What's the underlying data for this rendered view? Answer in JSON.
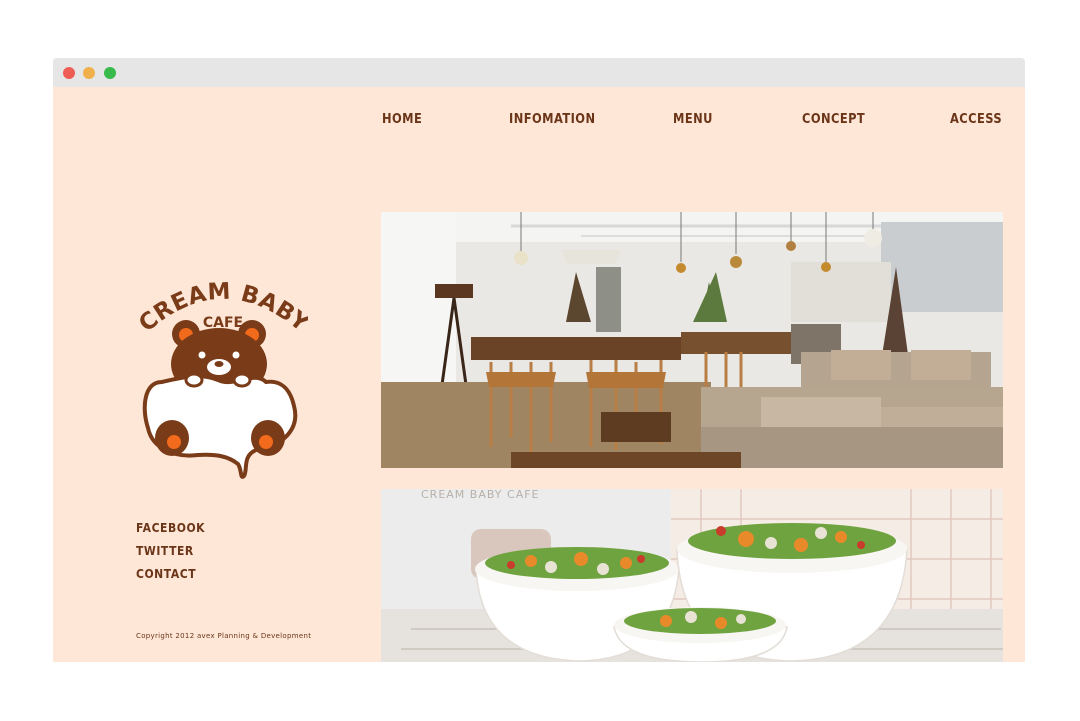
{
  "nav": {
    "items": [
      {
        "label": "HOME"
      },
      {
        "label": "INFOMATION"
      },
      {
        "label": "MENU"
      },
      {
        "label": "CONCEPT"
      },
      {
        "label": "ACCESS"
      }
    ]
  },
  "logo": {
    "line1": "CREAM BABY",
    "line2": "CAFE"
  },
  "social": {
    "items": [
      {
        "label": "FACEBOOK"
      },
      {
        "label": "TWITTER"
      },
      {
        "label": "CONTACT"
      }
    ]
  },
  "footer": {
    "copyright": "Copyright 2012 avex Planning & Development"
  },
  "photos": {
    "salad_sign": "CREAM BABY CAFE"
  },
  "colors": {
    "background": "#ffe7d8",
    "text_brown": "#6b3518",
    "bear_brown": "#7a3b18",
    "bear_orange": "#f26a1b",
    "titlebar": "#e6e6e6"
  }
}
